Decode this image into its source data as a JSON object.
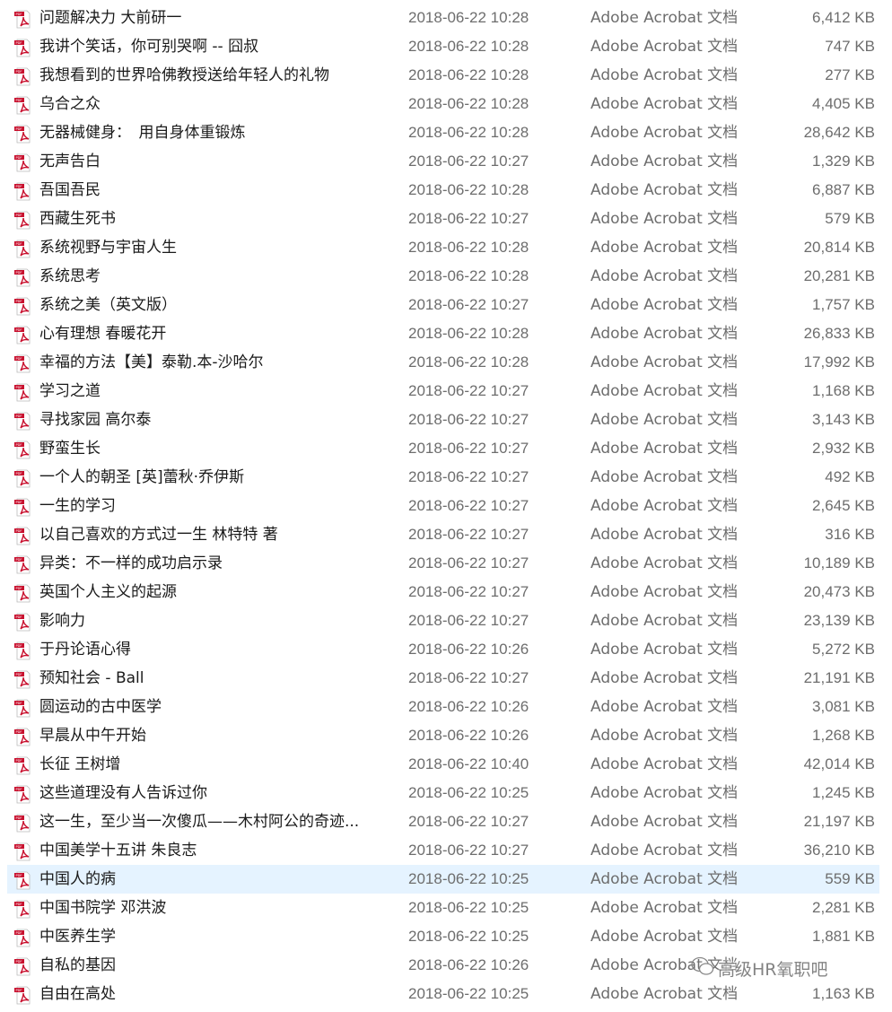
{
  "files": [
    {
      "name": "问题解决力 大前研一",
      "date": "2018-06-22 10:28",
      "type": "Adobe Acrobat 文档",
      "size": "6,412 KB"
    },
    {
      "name": "我讲个笑话，你可别哭啊 -- 囧叔",
      "date": "2018-06-22 10:28",
      "type": "Adobe Acrobat 文档",
      "size": "747 KB"
    },
    {
      "name": "我想看到的世界哈佛教授送给年轻人的礼物",
      "date": "2018-06-22 10:28",
      "type": "Adobe Acrobat 文档",
      "size": "277 KB"
    },
    {
      "name": "乌合之众",
      "date": "2018-06-22 10:28",
      "type": "Adobe Acrobat 文档",
      "size": "4,405 KB"
    },
    {
      "name": "无器械健身：　用自身体重锻炼",
      "date": "2018-06-22 10:28",
      "type": "Adobe Acrobat 文档",
      "size": "28,642 KB"
    },
    {
      "name": "无声告白",
      "date": "2018-06-22 10:27",
      "type": "Adobe Acrobat 文档",
      "size": "1,329 KB"
    },
    {
      "name": "吾国吾民",
      "date": "2018-06-22 10:28",
      "type": "Adobe Acrobat 文档",
      "size": "6,887 KB"
    },
    {
      "name": "西藏生死书",
      "date": "2018-06-22 10:27",
      "type": "Adobe Acrobat 文档",
      "size": "579 KB"
    },
    {
      "name": "系统视野与宇宙人生",
      "date": "2018-06-22 10:28",
      "type": "Adobe Acrobat 文档",
      "size": "20,814 KB"
    },
    {
      "name": "系统思考",
      "date": "2018-06-22 10:28",
      "type": "Adobe Acrobat 文档",
      "size": "20,281 KB"
    },
    {
      "name": "系统之美（英文版）",
      "date": "2018-06-22 10:27",
      "type": "Adobe Acrobat 文档",
      "size": "1,757 KB"
    },
    {
      "name": "心有理想 春暖花开",
      "date": "2018-06-22 10:28",
      "type": "Adobe Acrobat 文档",
      "size": "26,833 KB"
    },
    {
      "name": "幸福的方法【美】泰勒.本-沙哈尔",
      "date": "2018-06-22 10:28",
      "type": "Adobe Acrobat 文档",
      "size": "17,992 KB"
    },
    {
      "name": "学习之道",
      "date": "2018-06-22 10:27",
      "type": "Adobe Acrobat 文档",
      "size": "1,168 KB"
    },
    {
      "name": "寻找家园 高尔泰",
      "date": "2018-06-22 10:27",
      "type": "Adobe Acrobat 文档",
      "size": "3,143 KB"
    },
    {
      "name": "野蛮生长",
      "date": "2018-06-22 10:27",
      "type": "Adobe Acrobat 文档",
      "size": "2,932 KB"
    },
    {
      "name": "一个人的朝圣 [英]蕾秋·乔伊斯",
      "date": "2018-06-22 10:27",
      "type": "Adobe Acrobat 文档",
      "size": "492 KB"
    },
    {
      "name": "一生的学习",
      "date": "2018-06-22 10:27",
      "type": "Adobe Acrobat 文档",
      "size": "2,645 KB"
    },
    {
      "name": "以自己喜欢的方式过一生 林特特 著",
      "date": "2018-06-22 10:27",
      "type": "Adobe Acrobat 文档",
      "size": "316 KB"
    },
    {
      "name": "异类：不一样的成功启示录",
      "date": "2018-06-22 10:27",
      "type": "Adobe Acrobat 文档",
      "size": "10,189 KB"
    },
    {
      "name": "英国个人主义的起源",
      "date": "2018-06-22 10:27",
      "type": "Adobe Acrobat 文档",
      "size": "20,473 KB"
    },
    {
      "name": "影响力",
      "date": "2018-06-22 10:27",
      "type": "Adobe Acrobat 文档",
      "size": "23,139 KB"
    },
    {
      "name": "于丹论语心得",
      "date": "2018-06-22 10:26",
      "type": "Adobe Acrobat 文档",
      "size": "5,272 KB"
    },
    {
      "name": "预知社会 - Ball",
      "date": "2018-06-22 10:27",
      "type": "Adobe Acrobat 文档",
      "size": "21,191 KB"
    },
    {
      "name": "圆运动的古中医学",
      "date": "2018-06-22 10:26",
      "type": "Adobe Acrobat 文档",
      "size": "3,081 KB"
    },
    {
      "name": "早晨从中午开始",
      "date": "2018-06-22 10:26",
      "type": "Adobe Acrobat 文档",
      "size": "1,268 KB"
    },
    {
      "name": "长征 王树增",
      "date": "2018-06-22 10:40",
      "type": "Adobe Acrobat 文档",
      "size": "42,014 KB"
    },
    {
      "name": "这些道理没有人告诉过你",
      "date": "2018-06-22 10:25",
      "type": "Adobe Acrobat 文档",
      "size": "1,245 KB"
    },
    {
      "name": "这一生，至少当一次傻瓜——木村阿公的奇迹...",
      "date": "2018-06-22 10:27",
      "type": "Adobe Acrobat 文档",
      "size": "21,197 KB"
    },
    {
      "name": "中国美学十五讲 朱良志",
      "date": "2018-06-22 10:27",
      "type": "Adobe Acrobat 文档",
      "size": "36,210 KB"
    },
    {
      "name": "中国人的病",
      "date": "2018-06-22 10:25",
      "type": "Adobe Acrobat 文档",
      "size": "559 KB",
      "selected": true
    },
    {
      "name": "中国书院学 邓洪波",
      "date": "2018-06-22 10:25",
      "type": "Adobe Acrobat 文档",
      "size": "2,281 KB"
    },
    {
      "name": "中医养生学",
      "date": "2018-06-22 10:25",
      "type": "Adobe Acrobat 文档",
      "size": "1,881 KB"
    },
    {
      "name": "自私的基因",
      "date": "2018-06-22 10:26",
      "type": "Adobe Acrobat 文档",
      "size": ""
    },
    {
      "name": "自由在高处",
      "date": "2018-06-22 10:25",
      "type": "Adobe Acrobat 文档",
      "size": "1,163 KB"
    }
  ],
  "icon": "pdf-file-icon",
  "colors": {
    "selection": "#e5f3ff",
    "pdf_red": "#c8102e"
  },
  "watermark": {
    "text": "高级HR氧职吧",
    "icon": "wechat-icon"
  }
}
